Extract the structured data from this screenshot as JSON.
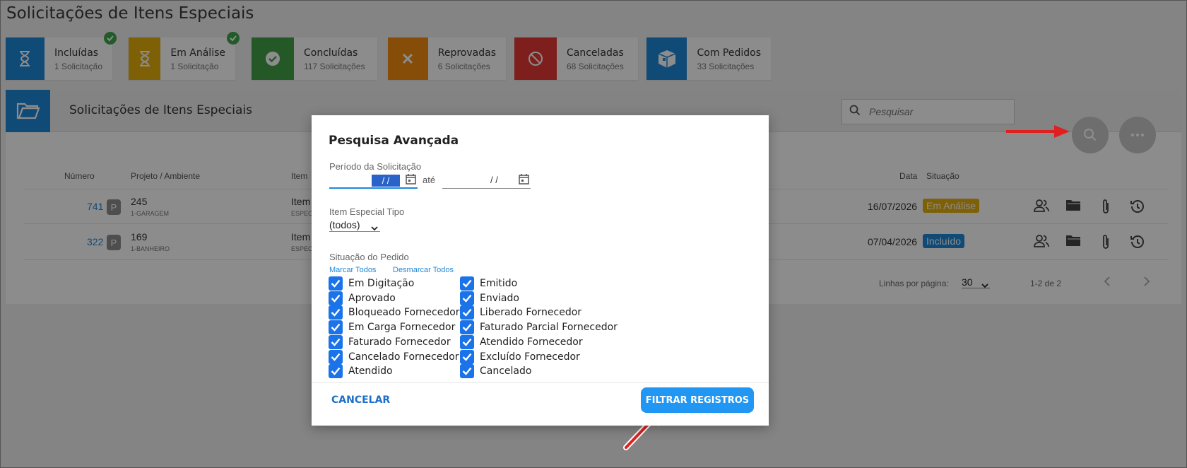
{
  "page": {
    "title": "Solicitações de Itens Especiais"
  },
  "cards": [
    {
      "title": "Incluídas",
      "count": "1 Solicitação",
      "color": "#1e88d9",
      "icon": "hourglass-icon",
      "checked": true
    },
    {
      "title": "Em Análise",
      "count": "1 Solicitação",
      "color": "#e5b00c",
      "icon": "hourglass-icon",
      "checked": true
    },
    {
      "title": "Concluídas",
      "count": "117 Solicitações",
      "color": "#43a047",
      "icon": "check-circle-icon",
      "checked": false
    },
    {
      "title": "Reprovadas",
      "count": "6 Solicitações",
      "color": "#f28c0f",
      "icon": "x-icon",
      "checked": false
    },
    {
      "title": "Canceladas",
      "count": "68 Solicitações",
      "color": "#e53935",
      "icon": "ban-icon",
      "checked": false
    },
    {
      "title": "Com Pedidos",
      "count": "33 Solicitações",
      "color": "#1e88d9",
      "icon": "package-icon",
      "checked": false
    }
  ],
  "panel": {
    "title": "Solicitações de Itens Especiais",
    "search_placeholder": "Pesquisar"
  },
  "table": {
    "headers": {
      "numero": "Número",
      "projeto": "Projeto / Ambiente",
      "item": "Item",
      "data": "Data",
      "situacao": "Situação"
    },
    "rows": [
      {
        "numero": "741",
        "badge": "P",
        "projeto": "245",
        "ambiente": "1-GARAGEM",
        "item": "Item",
        "item_sub": "ESPEC",
        "data": "16/07/2026",
        "situacao": "Em Análise",
        "situacao_color": "#e5b00c"
      },
      {
        "numero": "322",
        "badge": "P",
        "projeto": "169",
        "ambiente": "1-BANHEIRO",
        "item": "Item",
        "item_sub": "ESPEC",
        "data": "07/04/2026",
        "situacao": "Incluído",
        "situacao_color": "#1e88d9"
      }
    ],
    "rows_per_page_label": "Linhas por página:",
    "rows_per_page": "30",
    "range": "1-2 de 2"
  },
  "modal": {
    "title": "Pesquisa Avançada",
    "period_label": "Período da Solicitação",
    "date_from": " / /",
    "date_to": " /  /",
    "ate_label": "até",
    "item_tipo_label": "Item Especial Tipo",
    "item_tipo_value": "(todos)",
    "situacao_label": "Situação do Pedido",
    "marcar_todos": "Marcar Todos",
    "desmarcar_todos": "Desmarcar Todos",
    "col1": [
      "Em Digitação",
      "Aprovado",
      "Bloqueado Fornecedor",
      "Em Carga Fornecedor",
      "Faturado Fornecedor",
      "Cancelado Fornecedor",
      "Atendido"
    ],
    "col2": [
      "Emitido",
      "Enviado",
      "Liberado Fornecedor",
      "Faturado Parcial Fornecedor",
      "Atendido Fornecedor",
      "Excluído Fornecedor",
      "Cancelado"
    ],
    "cancel_label": "CANCELAR",
    "filter_label": "FILTRAR REGISTROS"
  }
}
